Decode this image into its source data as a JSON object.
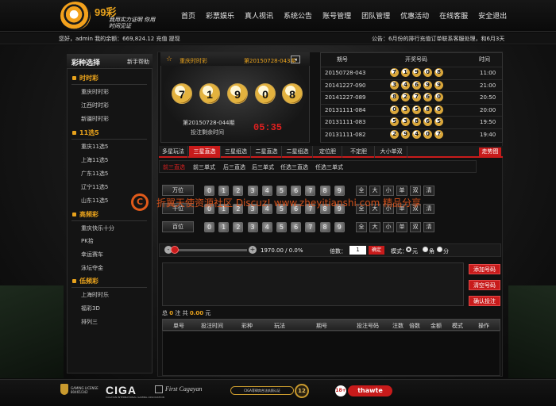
{
  "brand": {
    "name": "99彩",
    "slogan": "我用实力证明 你用时间见证"
  },
  "nav": [
    "首页",
    "彩票娱乐",
    "真人视讯",
    "系统公告",
    "账号管理",
    "团队管理",
    "优惠活动",
    "在线客服",
    "安全退出"
  ],
  "user_info": "您好，admin  我的余额：669,824.12  充值   提现",
  "notice": "公告：6月份的排行充值订单联系客服处理，和6月3天",
  "sidebar": {
    "title": "彩种选择",
    "help": "新手帮助",
    "categories": [
      {
        "name": "时时彩",
        "items": [
          "重庆时时彩",
          "江西时时彩",
          "新疆时时彩"
        ]
      },
      {
        "name": "11选5",
        "items": [
          "重庆11选5",
          "上海11选5",
          "广东11选5",
          "辽宁11选5",
          "山东11选5"
        ]
      },
      {
        "name": "高频彩",
        "items": [
          "重庆快乐十分",
          "PK拾",
          "幸运赛车",
          "泳坛夺金"
        ]
      },
      {
        "name": "低频彩",
        "items": [
          "上海时时乐",
          "福彩3D",
          "排列三"
        ]
      }
    ]
  },
  "draw": {
    "game": "重庆时时彩",
    "current_issue": "第20150728-043期",
    "balls": [
      "7",
      "1",
      "9",
      "0",
      "8"
    ],
    "next_issue": "第20150728-044期",
    "countdown_label": "投注剩余时间",
    "countdown": "05:35"
  },
  "history": {
    "headers": [
      "期号",
      "开奖号码",
      "时间"
    ],
    "rows": [
      {
        "issue": "20150728-043",
        "nums": [
          "7",
          "1",
          "9",
          "0",
          "8"
        ],
        "time": "11:00"
      },
      {
        "issue": "20141227-090",
        "nums": [
          "3",
          "4",
          "6",
          "9",
          "9"
        ],
        "time": "21:00"
      },
      {
        "issue": "20141227-089",
        "nums": [
          "8",
          "2",
          "7",
          "6",
          "0"
        ],
        "time": "20:50"
      },
      {
        "issue": "20131111-084",
        "nums": [
          "0",
          "3",
          "5",
          "8",
          "0"
        ],
        "time": "20:00"
      },
      {
        "issue": "20131111-083",
        "nums": [
          "5",
          "3",
          "8",
          "6",
          "5"
        ],
        "time": "19:50"
      },
      {
        "issue": "20131111-082",
        "nums": [
          "2",
          "9",
          "4",
          "0",
          "7"
        ],
        "time": "19:40"
      }
    ]
  },
  "tabs": [
    "多星玩法",
    "三星直选",
    "三星组选",
    "二星直选",
    "二星组选",
    "定位胆",
    "不定胆",
    "大小单双"
  ],
  "trend_button": "走势图",
  "subtabs": [
    "前三直选",
    "前三单式",
    "后三直选",
    "后三单式",
    "任选三直选",
    "任选三单式"
  ],
  "positions": [
    "万位",
    "千位",
    "百位"
  ],
  "digits": [
    "0",
    "1",
    "2",
    "3",
    "4",
    "5",
    "6",
    "7",
    "8",
    "9"
  ],
  "quick": [
    "全",
    "大",
    "小",
    "单",
    "双",
    "清"
  ],
  "watermark": "折翼天使资源社区 Discuz! www.zheyitianshi.com 精品分享",
  "multiplier": {
    "minus": "-",
    "plus": "+",
    "rebate": "1970.00 / 0.0%",
    "slider_fraction": 0.0,
    "label": "倍数：",
    "value": "1",
    "ok": "确定",
    "mode_label": "模式：",
    "modes": [
      "元",
      "角",
      "分"
    ],
    "selected_mode": "元"
  },
  "actions": [
    "添加号码",
    "清空号码",
    "确认投注"
  ],
  "summary": {
    "prefix": "总",
    "count": "0",
    "mid": "注 共",
    "amount": "0.00",
    "suffix": "元"
  },
  "order_headers": [
    "单号",
    "投注时间",
    "彩种",
    "玩法",
    "期号",
    "投注号码",
    "注数",
    "倍数",
    "金额",
    "模式",
    "操作"
  ],
  "footer": {
    "license": "GAMING LICENSE 80465/342",
    "ciga": "CIGA",
    "ciga_sub": "CAGAYAN INTERNATIONAL GAMING ASSOCIATION",
    "first_cagayan": "First Cagayan",
    "pill": "CIGA菲律宾合法执照认证",
    "seal": "12",
    "age": "18+",
    "thawte": "thawte"
  },
  "colors": {
    "accent": "#c81b1b",
    "gold": "#e8a21c",
    "background": "#0b0b0b"
  }
}
